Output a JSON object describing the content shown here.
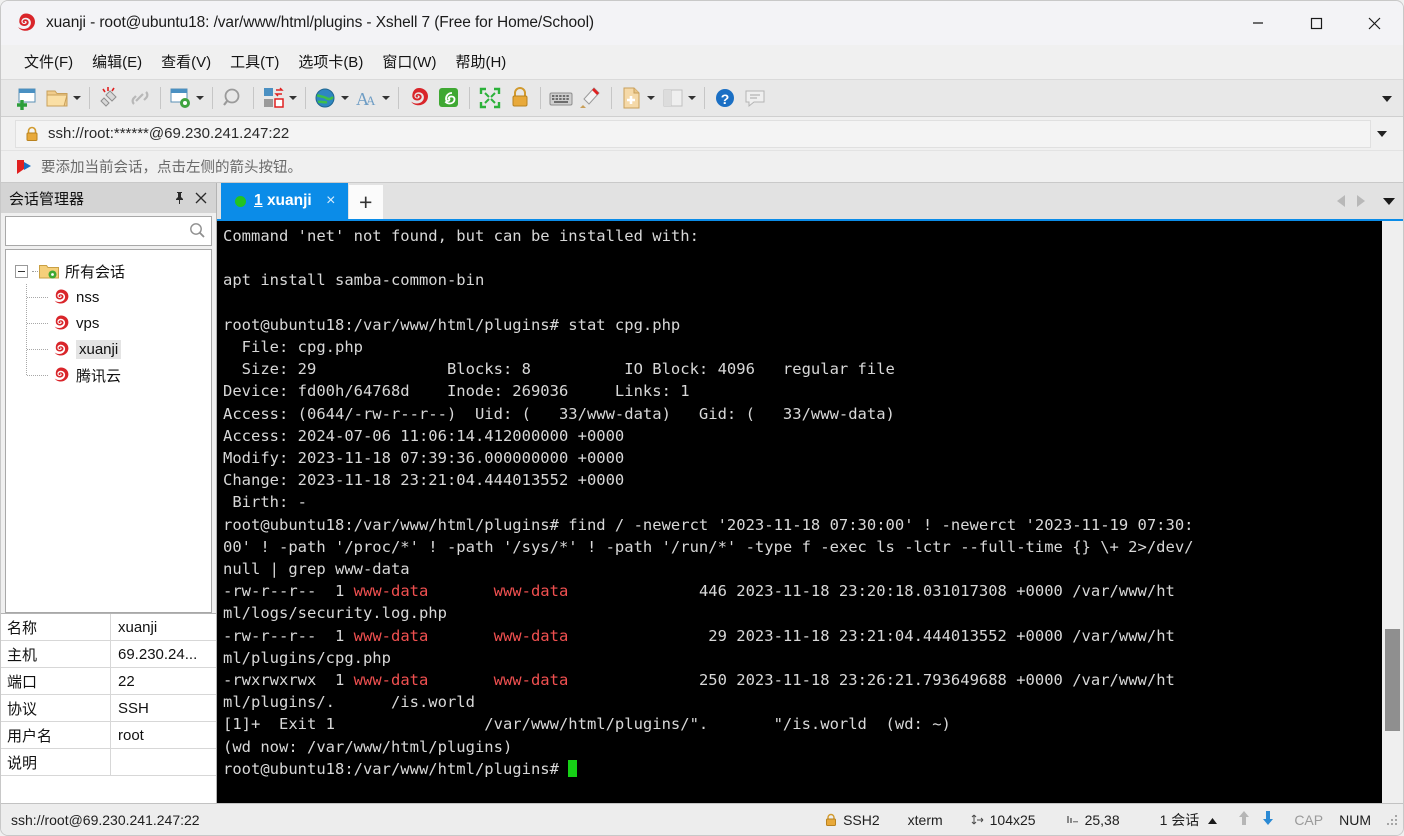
{
  "window": {
    "title": "xuanji - root@ubuntu18: /var/www/html/plugins - Xshell 7 (Free for Home/School)",
    "minimize_label": "minimize-icon",
    "maximize_label": "maximize-icon",
    "close_label": "close-icon"
  },
  "menu": {
    "items": [
      {
        "label": "文件(F)"
      },
      {
        "label": "编辑(E)"
      },
      {
        "label": "查看(V)"
      },
      {
        "label": "工具(T)"
      },
      {
        "label": "选项卡(B)"
      },
      {
        "label": "窗口(W)"
      },
      {
        "label": "帮助(H)"
      }
    ]
  },
  "toolbar": {
    "icons": [
      "new-session-icon",
      "open-folder-icon",
      "disconnect-icon",
      "link-icon",
      "session-properties-icon",
      "find-icon",
      "transfer-icon",
      "globe-icon",
      "font-icon",
      "xshell-icon",
      "xftp-icon",
      "fullscreen-icon",
      "lock-icon",
      "keyboard-icon",
      "highlight-icon",
      "add-note-icon",
      "layout-icon",
      "help-icon",
      "chat-icon"
    ],
    "overflow_label": "toolbar-overflow-icon"
  },
  "address": {
    "lock_icon": "lock-icon",
    "value": "ssh://root:******@69.230.241.247:22",
    "placeholder": "ssh://",
    "dropdown_label": "address-dropdown-icon"
  },
  "notice": {
    "icon": "flag-icon",
    "text": "要添加当前会话，点击左侧的箭头按钮。"
  },
  "sidebar": {
    "title": "会话管理器",
    "pin_label": "pin-icon",
    "close_label": "close-icon",
    "search": {
      "value": "",
      "placeholder": ""
    },
    "tree": {
      "root": {
        "label": "所有会话",
        "icon": "folder-icon"
      },
      "children": [
        {
          "label": "nss",
          "selected": false
        },
        {
          "label": "vps",
          "selected": false
        },
        {
          "label": "xuanji",
          "selected": true
        },
        {
          "label": "腾讯云",
          "selected": false
        }
      ]
    },
    "properties": [
      {
        "key": "名称",
        "value": "xuanji"
      },
      {
        "key": "主机",
        "value": "69.230.24..."
      },
      {
        "key": "端口",
        "value": "22"
      },
      {
        "key": "协议",
        "value": "SSH"
      },
      {
        "key": "用户名",
        "value": "root"
      },
      {
        "key": "说明",
        "value": ""
      }
    ]
  },
  "tabs": {
    "items": [
      {
        "number": "1",
        "label": "xuanji",
        "status": "connected",
        "close_label": "close-icon"
      }
    ],
    "new_tab_label": "+",
    "nav": {
      "prev": "prev-tab-icon",
      "next": "next-tab-icon",
      "list": "tab-list-icon"
    }
  },
  "terminal": {
    "lines": [
      [
        {
          "t": "Command 'net' not found, but can be installed with:"
        }
      ],
      [
        {
          "t": ""
        }
      ],
      [
        {
          "t": "apt install samba-common-bin"
        }
      ],
      [
        {
          "t": ""
        }
      ],
      [
        {
          "t": "root@ubuntu18:/var/www/html/plugins# stat cpg.php"
        }
      ],
      [
        {
          "t": "  File: cpg.php"
        }
      ],
      [
        {
          "t": "  Size: 29              Blocks: 8          IO Block: 4096   regular file"
        }
      ],
      [
        {
          "t": "Device: fd00h/64768d    Inode: 269036     Links: 1"
        }
      ],
      [
        {
          "t": "Access: (0644/-rw-r--r--)  Uid: (   33/www-data)   Gid: (   33/www-data)"
        }
      ],
      [
        {
          "t": "Access: 2024-07-06 11:06:14.412000000 +0000"
        }
      ],
      [
        {
          "t": "Modify: 2023-11-18 07:39:36.000000000 +0000"
        }
      ],
      [
        {
          "t": "Change: 2023-11-18 23:21:04.444013552 +0000"
        }
      ],
      [
        {
          "t": " Birth: -"
        }
      ],
      [
        {
          "t": "root@ubuntu18:/var/www/html/plugins# find / -newerct '2023-11-18 07:30:00' ! -newerct '2023-11-19 07:30:"
        }
      ],
      [
        {
          "t": "00' ! -path '/proc/*' ! -path '/sys/*' ! -path '/run/*' -type f -exec ls -lctr --full-time {} \\+ 2>/dev/"
        }
      ],
      [
        {
          "t": "null | grep www-data"
        }
      ],
      [
        {
          "t": "-rw-r--r--  1 "
        },
        {
          "t": "www-data",
          "c": "red"
        },
        {
          "t": "       "
        },
        {
          "t": "www-data",
          "c": "red"
        },
        {
          "t": "              446 2023-11-18 23:20:18.031017308 +0000 /var/www/ht"
        }
      ],
      [
        {
          "t": "ml/logs/security.log.php"
        }
      ],
      [
        {
          "t": "-rw-r--r--  1 "
        },
        {
          "t": "www-data",
          "c": "red"
        },
        {
          "t": "       "
        },
        {
          "t": "www-data",
          "c": "red"
        },
        {
          "t": "               29 2023-11-18 23:21:04.444013552 +0000 /var/www/ht"
        }
      ],
      [
        {
          "t": "ml/plugins/cpg.php"
        }
      ],
      [
        {
          "t": "-rwxrwxrwx  1 "
        },
        {
          "t": "www-data",
          "c": "red"
        },
        {
          "t": "       "
        },
        {
          "t": "www-data",
          "c": "red"
        },
        {
          "t": "              250 2023-11-18 23:26:21.793649688 +0000 /var/www/ht"
        }
      ],
      [
        {
          "t": "ml/plugins/.      /is.world"
        }
      ],
      [
        {
          "t": "[1]+  Exit 1                /var/www/html/plugins/\".       \"/is.world  (wd: ~)"
        }
      ],
      [
        {
          "t": "(wd now: /var/www/html/plugins)"
        }
      ],
      [
        {
          "t": "root@ubuntu18:/var/www/html/plugins# "
        },
        {
          "t": "",
          "cursor": true
        }
      ]
    ]
  },
  "statusbar": {
    "url": "ssh://root@69.230.241.247:22",
    "security": {
      "icon": "lock-icon",
      "label": "SSH2"
    },
    "terminal_type": "xterm",
    "size": {
      "icon": "resize-icon",
      "label": "104x25"
    },
    "cursor_pos": {
      "icon": "cursor-icon",
      "label": "25,38"
    },
    "sessions": {
      "label": "1 会话",
      "caret": "caret-up-icon"
    },
    "upload_icon": "upload-arrow-icon",
    "download_icon": "download-arrow-icon",
    "caps": "CAP",
    "num": "NUM"
  },
  "colors": {
    "accent": "#0b8ce8",
    "terminal_bg": "#000000",
    "terminal_fg": "#d8d8d8",
    "terminal_red": "#f05050",
    "cursor": "#16d016",
    "connected_dot": "#22c322"
  }
}
